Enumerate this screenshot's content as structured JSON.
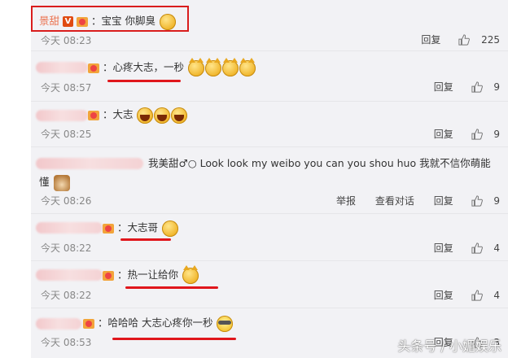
{
  "comments": [
    {
      "author": "景甜",
      "text": "：宝宝 你脚臭",
      "time": "今天 08:23",
      "reply": "回复",
      "likes": "225"
    },
    {
      "text": "：心疼大志，一秒",
      "time": "今天 08:57",
      "reply": "回复",
      "likes": "9"
    },
    {
      "text": "：大志",
      "time": "今天 08:25",
      "reply": "回复",
      "likes": "9"
    },
    {
      "text": "我美甜♂○  Look look my weibo you can you shou huo 我就不信你萌能",
      "text2": "懂",
      "time": "今天 08:26",
      "report": "举报",
      "view_conversation": "查看对话",
      "reply": "回复",
      "likes": "9"
    },
    {
      "text": "：大志哥",
      "time": "今天 08:22",
      "reply": "回复",
      "likes": "4"
    },
    {
      "text": "：热一让给你",
      "time": "今天 08:22",
      "reply": "回复",
      "likes": "4"
    },
    {
      "text": "：哈哈哈 大志心疼你一秒",
      "time": "今天 08:53",
      "reply": "回复",
      "likes": "3"
    }
  ],
  "watermark": "头条号 / 小媚娱乐"
}
